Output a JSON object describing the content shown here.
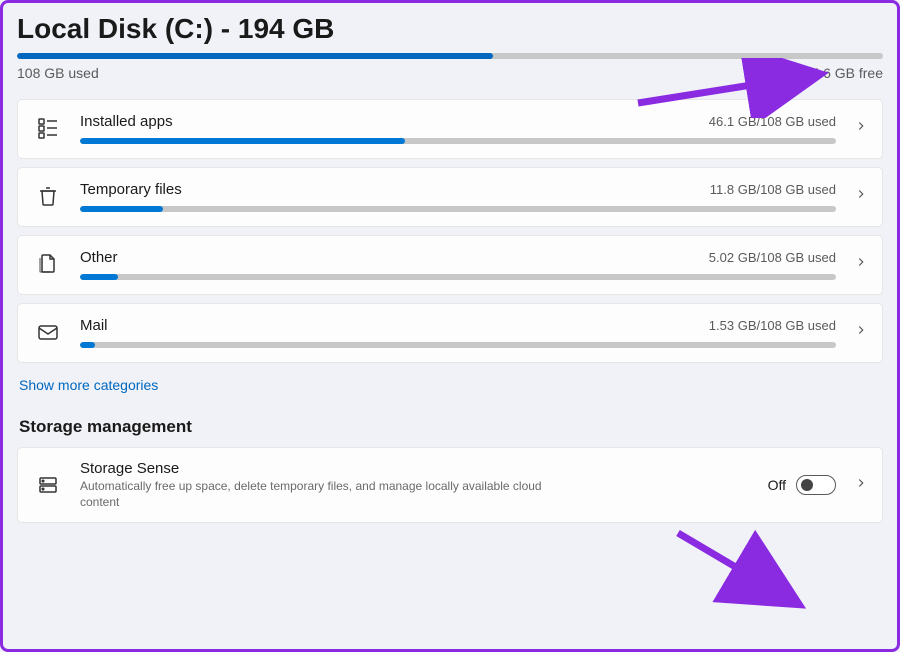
{
  "header": {
    "title": "Local Disk (C:) - 194 GB",
    "used_label": "108 GB used",
    "free_label": "85.6 GB free",
    "fill_percent": 55
  },
  "categories": [
    {
      "id": "installed-apps",
      "label": "Installed apps",
      "meta": "46.1 GB/108 GB used",
      "percent": 43,
      "icon": "apps"
    },
    {
      "id": "temporary-files",
      "label": "Temporary files",
      "meta": "11.8 GB/108 GB used",
      "percent": 11,
      "icon": "trash"
    },
    {
      "id": "other",
      "label": "Other",
      "meta": "5.02 GB/108 GB used",
      "percent": 5,
      "icon": "docs"
    },
    {
      "id": "mail",
      "label": "Mail",
      "meta": "1.53 GB/108 GB used",
      "percent": 2,
      "icon": "mail"
    }
  ],
  "show_more_label": "Show more categories",
  "section_heading": "Storage management",
  "storage_sense": {
    "title": "Storage Sense",
    "desc": "Automatically free up space, delete temporary files, and manage locally available cloud content",
    "state_label": "Off"
  },
  "colors": {
    "accent": "#0067c0",
    "bar_fill": "#0078d4",
    "annotation": "#8a2be2"
  }
}
